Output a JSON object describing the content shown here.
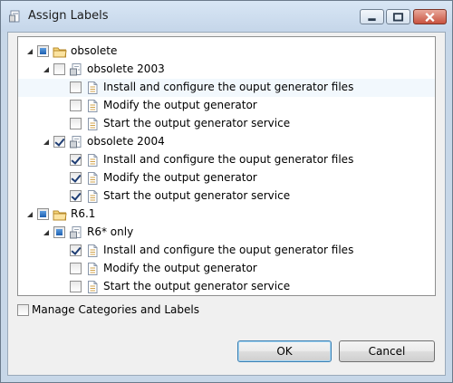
{
  "window": {
    "title": "Assign Labels",
    "controls": {
      "minimize": "minimize",
      "maximize": "maximize",
      "close": "close"
    }
  },
  "tree": [
    {
      "level": 0,
      "expanded": true,
      "check": "partial",
      "icon": "folder-icon",
      "label": "obsolete",
      "hover": false
    },
    {
      "level": 1,
      "expanded": true,
      "check": "unchecked",
      "icon": "category-icon",
      "label": "obsolete 2003",
      "hover": false
    },
    {
      "level": 2,
      "expanded": null,
      "check": "unchecked",
      "icon": "document-icon",
      "label": "Install and configure the ouput generator files",
      "hover": true
    },
    {
      "level": 2,
      "expanded": null,
      "check": "unchecked",
      "icon": "document-icon",
      "label": "Modify the output generator",
      "hover": false
    },
    {
      "level": 2,
      "expanded": null,
      "check": "unchecked",
      "icon": "document-icon",
      "label": "Start the output generator service",
      "hover": false
    },
    {
      "level": 1,
      "expanded": true,
      "check": "checked",
      "icon": "category-icon",
      "label": "obsolete 2004",
      "hover": false
    },
    {
      "level": 2,
      "expanded": null,
      "check": "checked",
      "icon": "document-icon",
      "label": "Install and configure the ouput generator files",
      "hover": false
    },
    {
      "level": 2,
      "expanded": null,
      "check": "checked",
      "icon": "document-icon",
      "label": "Modify the output generator",
      "hover": false
    },
    {
      "level": 2,
      "expanded": null,
      "check": "checked",
      "icon": "document-icon",
      "label": "Start the output generator service",
      "hover": false
    },
    {
      "level": 0,
      "expanded": true,
      "check": "partial",
      "icon": "folder-icon",
      "label": "R6.1",
      "hover": false
    },
    {
      "level": 1,
      "expanded": true,
      "check": "partial",
      "icon": "category-icon",
      "label": "R6* only",
      "hover": false
    },
    {
      "level": 2,
      "expanded": null,
      "check": "checked",
      "icon": "document-icon",
      "label": "Install and configure the ouput generator files",
      "hover": false
    },
    {
      "level": 2,
      "expanded": null,
      "check": "unchecked",
      "icon": "document-icon",
      "label": "Modify the output generator",
      "hover": false
    },
    {
      "level": 2,
      "expanded": null,
      "check": "unchecked",
      "icon": "document-icon",
      "label": "Start the output generator service",
      "hover": false
    }
  ],
  "manage": {
    "label": "Manage Categories and Labels",
    "checked": false
  },
  "buttons": {
    "ok": "OK",
    "cancel": "Cancel"
  }
}
